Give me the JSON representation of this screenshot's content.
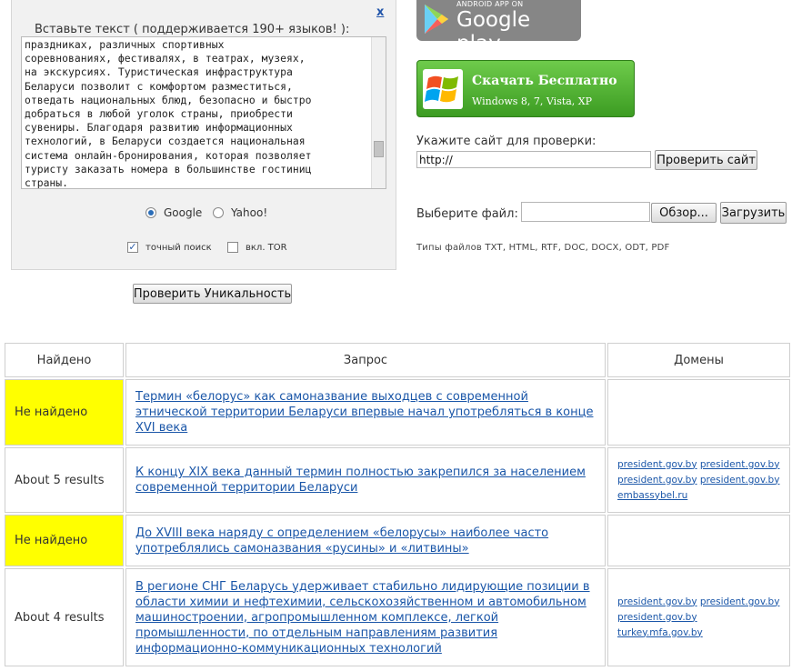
{
  "left_panel": {
    "close_label": "x",
    "prompt": "Вставьте текст ( поддерживается 190+ языков! ):",
    "text_lines": [
      "праздниках, различных спортивных",
      "соревнованиях, фестивалях, в театрах, музеях,",
      "на экскурсиях. Туристическая инфраструктура",
      "Беларуси позволит с комфортом разместиться,",
      "отведать национальных блюд, безопасно и быстро",
      "добраться в любой уголок страны, приобрести",
      "сувениры. Благодаря развитию информационных",
      "технологий, в Беларуси создается национальная",
      "система онлайн-бронирования, которая позволяет",
      "туристу заказать номера в большинстве гостиниц",
      "страны."
    ],
    "engine_google": "Google",
    "engine_yahoo": "Yahoo!",
    "exact_search": "точный поиск",
    "tor_label": "вкл. TOR",
    "check_button": "Проверить Уникальность"
  },
  "promo": {
    "gplay_small": "ANDROID APP ON",
    "gplay_big": "Google play",
    "download_title": "Скачать Бесплатно",
    "download_sub": "Windows 8, 7, Vista, XP"
  },
  "site_check": {
    "label": "Укажите сайт для проверки:",
    "value": "http://",
    "button": "Проверить сайт"
  },
  "file_upload": {
    "label": "Выберите файл:",
    "browse": "Обзор...",
    "upload": "Загрузить",
    "types": "Типы файлов TXT, HTML, RTF, DOC, DOCX, ODT, PDF"
  },
  "table": {
    "headers": [
      "Найдено",
      "Запрос",
      "Домены"
    ],
    "rows": [
      {
        "found": "Не найдено",
        "query": "Термин «белорус» как самоназвание выходцев с современной этнической территории Беларуси впервые начал употребляться в конце XVI века",
        "domains": []
      },
      {
        "found": "About 5 results",
        "query": "К концу XIX века данный термин полностью закрепился за населением современной территории Беларуси",
        "domains": [
          "president.gov.by",
          "president.gov.by",
          "president.gov.by",
          "president.gov.by",
          "embassybel.ru"
        ]
      },
      {
        "found": "Не найдено",
        "query": "До XVIII века наряду с определением «белорусы» наиболее часто употреблялись самоназвания «русины» и «литвины»",
        "domains": []
      },
      {
        "found": "About 4 results",
        "query": "В регионе СНГ Беларусь удерживает стабильно лидирующие позиции в области химии и нефтехимии, сельскохозяйственном и автомобильном машиностроении, агропромышленном комплексе, легкой промышленности, по отдельным направлениям развития информационно-коммуникационных технологий",
        "domains": [
          "president.gov.by",
          "president.gov.by",
          "president.gov.by",
          "turkey.mfa.gov.by"
        ]
      }
    ]
  },
  "colors": {
    "not_found_bg": "#ffff00",
    "link": "#1a56a8",
    "download_green": "#4caf2a"
  }
}
